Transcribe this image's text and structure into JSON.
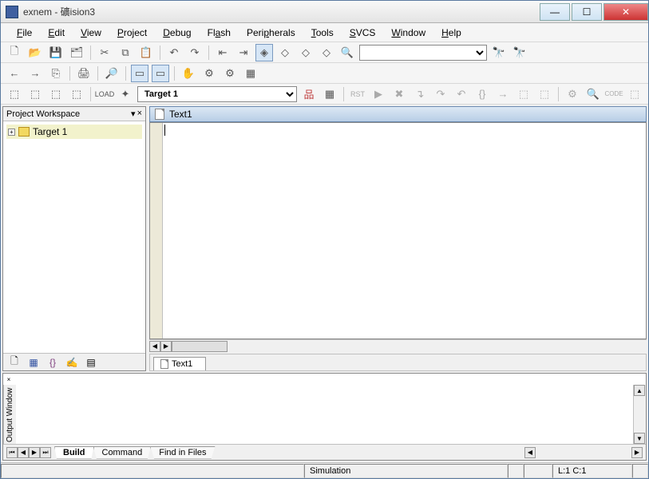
{
  "window": {
    "title": "exnem - 礦ision3"
  },
  "menu": [
    {
      "label": "File",
      "u": 0
    },
    {
      "label": "Edit",
      "u": 0
    },
    {
      "label": "View",
      "u": 0
    },
    {
      "label": "Project",
      "u": 0
    },
    {
      "label": "Debug",
      "u": 0
    },
    {
      "label": "Flash",
      "u": -1
    },
    {
      "label": "Peripherals",
      "u": 4
    },
    {
      "label": "Tools",
      "u": 0
    },
    {
      "label": "SVCS",
      "u": 0
    },
    {
      "label": "Window",
      "u": 0
    },
    {
      "label": "Help",
      "u": 0
    }
  ],
  "target_combo": "Target 1",
  "workspace": {
    "title": "Project Workspace",
    "root": "Target 1"
  },
  "editor": {
    "title": "Text1",
    "tab": "Text1"
  },
  "output": {
    "label": "Output Window",
    "tabs": [
      "Build",
      "Command",
      "Find in Files"
    ]
  },
  "status": {
    "mode": "Simulation",
    "pos": "L:1 C:1"
  }
}
